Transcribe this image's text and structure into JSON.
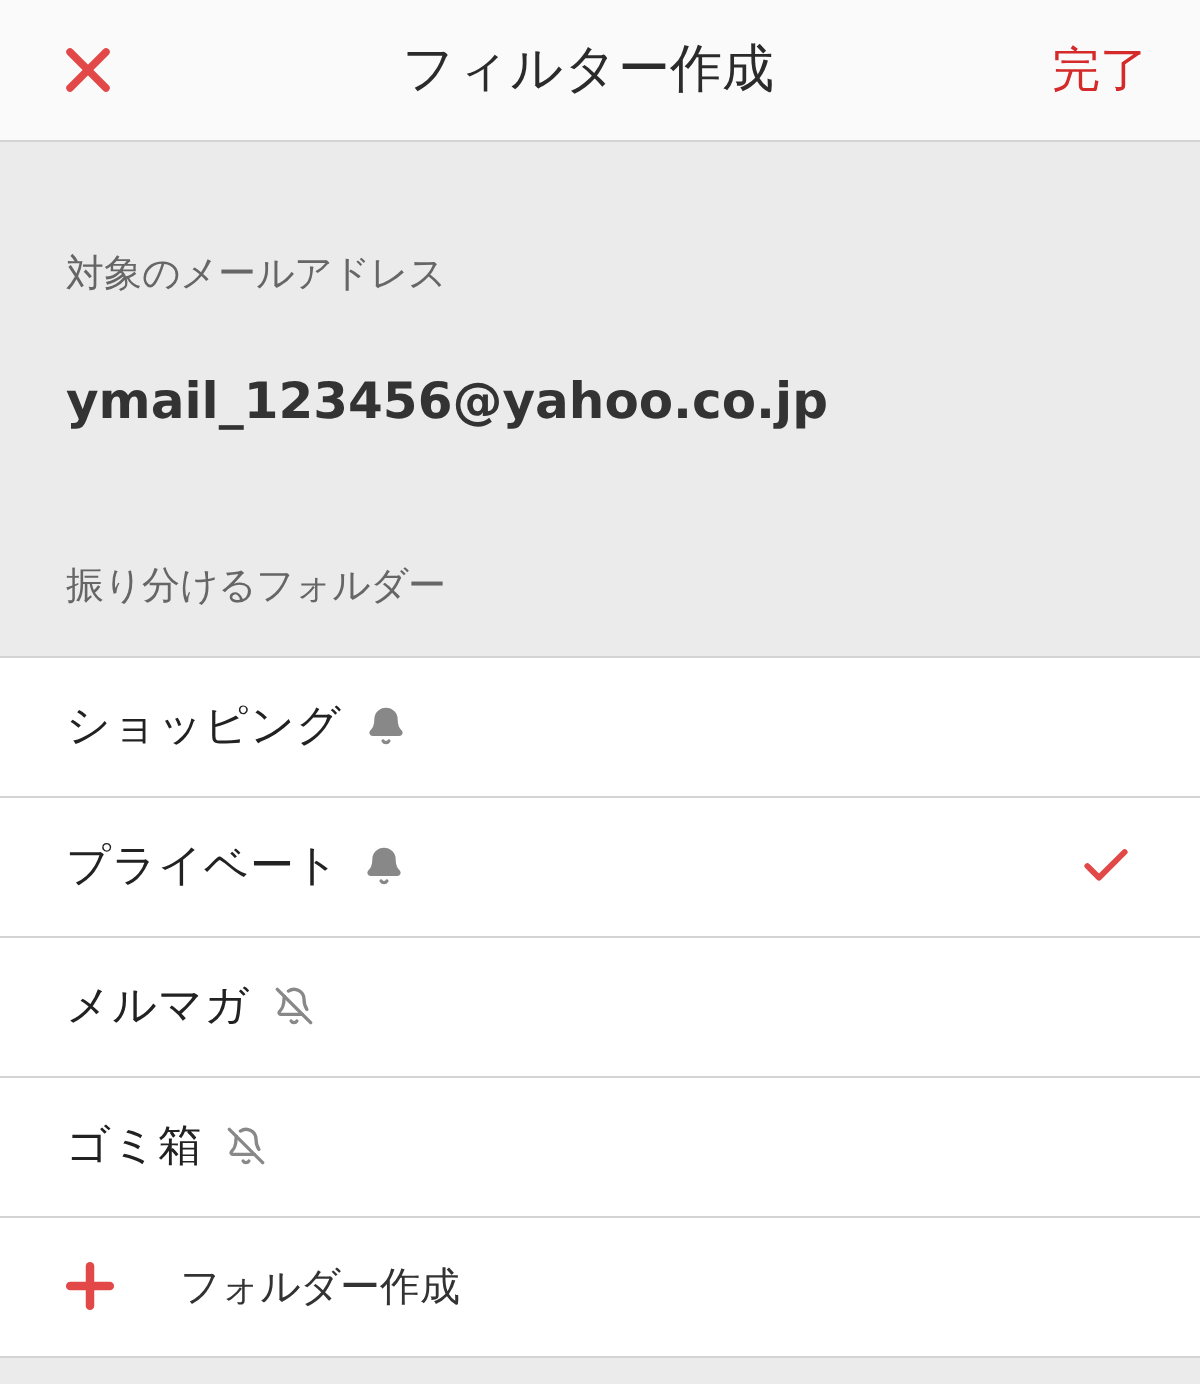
{
  "header": {
    "title": "フィルター作成",
    "done": "完了"
  },
  "target": {
    "label": "対象のメールアドレス",
    "address": "ymail_123456@yahoo.co.jp"
  },
  "folders_label": "振り分けるフォルダー",
  "folders": [
    {
      "name": "ショッピング",
      "notify": true,
      "selected": false
    },
    {
      "name": "プライベート",
      "notify": true,
      "selected": true
    },
    {
      "name": "メルマガ",
      "notify": false,
      "selected": false
    },
    {
      "name": "ゴミ箱",
      "notify": false,
      "selected": false
    }
  ],
  "create_folder": "フォルダー作成"
}
